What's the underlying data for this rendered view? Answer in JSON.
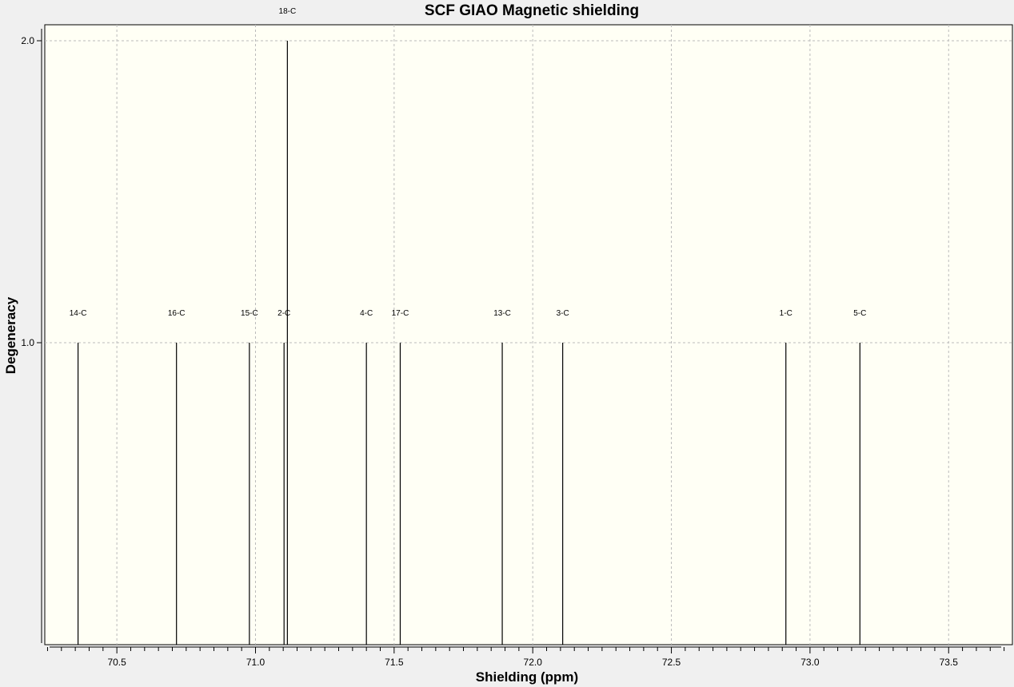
{
  "chart_data": {
    "type": "bar",
    "title": "SCF GIAO Magnetic shielding",
    "xlabel": "Shielding (ppm)",
    "ylabel": "Degeneracy",
    "xlim": [
      70.24,
      73.73
    ],
    "ylim": [
      0,
      2.15
    ],
    "x_ticks": [
      "70.5",
      "71.0",
      "71.5",
      "72.0",
      "72.5",
      "73.0",
      "73.5"
    ],
    "y_ticks": [
      "1.0",
      "2.0"
    ],
    "grid": true,
    "peaks": [
      {
        "label": "14-C",
        "x": 70.36,
        "y": 1
      },
      {
        "label": "16-C",
        "x": 70.715,
        "y": 1
      },
      {
        "label": "15-C",
        "x": 70.978,
        "y": 1
      },
      {
        "label": "2-C",
        "x": 71.103,
        "y": 1
      },
      {
        "label": "18-C",
        "x": 71.115,
        "y": 2
      },
      {
        "label": "4-C",
        "x": 71.4,
        "y": 1
      },
      {
        "label": "17-C",
        "x": 71.522,
        "y": 1
      },
      {
        "label": "13-C",
        "x": 71.89,
        "y": 1
      },
      {
        "label": "3-C",
        "x": 72.108,
        "y": 1
      },
      {
        "label": "1-C",
        "x": 72.913,
        "y": 1
      },
      {
        "label": "5-C",
        "x": 73.18,
        "y": 1
      }
    ],
    "colors": {
      "background": "#fffff5",
      "line": "#000000",
      "grid": "#bbbbbb"
    }
  }
}
